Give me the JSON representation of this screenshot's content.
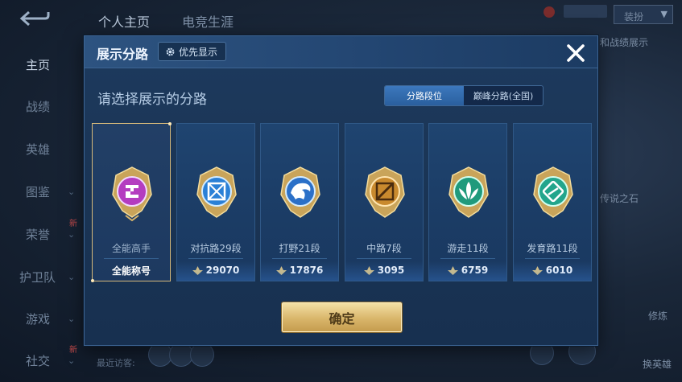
{
  "background": {
    "tabs": [
      "个人主页",
      "电竞生涯"
    ],
    "nav_items": [
      {
        "label": "主页",
        "active": true,
        "chevron": false,
        "new": false
      },
      {
        "label": "战绩",
        "active": false,
        "chevron": false,
        "new": false
      },
      {
        "label": "英雄",
        "active": false,
        "chevron": false,
        "new": false
      },
      {
        "label": "图鉴",
        "active": false,
        "chevron": true,
        "new": false
      },
      {
        "label": "荣誉",
        "active": false,
        "chevron": true,
        "new": true
      },
      {
        "label": "护卫队",
        "active": false,
        "chevron": true,
        "new": false
      },
      {
        "label": "游戏",
        "active": false,
        "chevron": true,
        "new": false
      },
      {
        "label": "社交",
        "active": false,
        "chevron": true,
        "new": true
      }
    ],
    "new_tag": "新",
    "right_texts": [
      "装扮",
      "和战绩展示",
      "传说之石",
      "修炼",
      "换英雄"
    ],
    "visitors_label": "最近访客:"
  },
  "modal": {
    "title": "展示分路",
    "priority_button": {
      "label": "优先显示",
      "icon": "gear-icon"
    },
    "close_icon": "close-icon",
    "subtitle": "请选择展示的分路",
    "toggle": [
      {
        "label": "分路段位",
        "active": true
      },
      {
        "label": "巅峰分路(全国)",
        "active": false
      }
    ],
    "cards": [
      {
        "label": "全能高手",
        "score": "全能称号",
        "selected": true,
        "badge_color": "#c23cc4",
        "badge_icon": "all-round-icon"
      },
      {
        "label": "对抗路29段",
        "score": "29070",
        "selected": false,
        "badge_color": "#2b80d6",
        "badge_icon": "clash-lane-icon"
      },
      {
        "label": "打野21段",
        "score": "17876",
        "selected": false,
        "badge_color": "#2b70c8",
        "badge_icon": "jungle-dragon-icon"
      },
      {
        "label": "中路7段",
        "score": "3095",
        "selected": false,
        "badge_color": "#c98a2e",
        "badge_icon": "mid-lane-icon"
      },
      {
        "label": "游走11段",
        "score": "6759",
        "selected": false,
        "badge_color": "#1f9a7c",
        "badge_icon": "roam-icon"
      },
      {
        "label": "发育路11段",
        "score": "6010",
        "selected": false,
        "badge_color": "#22a58c",
        "badge_icon": "farm-lane-icon"
      }
    ],
    "points_icon": "rank-points-icon",
    "confirm_label": "确定"
  },
  "colors": {
    "accent_gold": "#d6b97a",
    "toggle_active": "#3c78bd",
    "modal_bg": "#1a3454"
  }
}
